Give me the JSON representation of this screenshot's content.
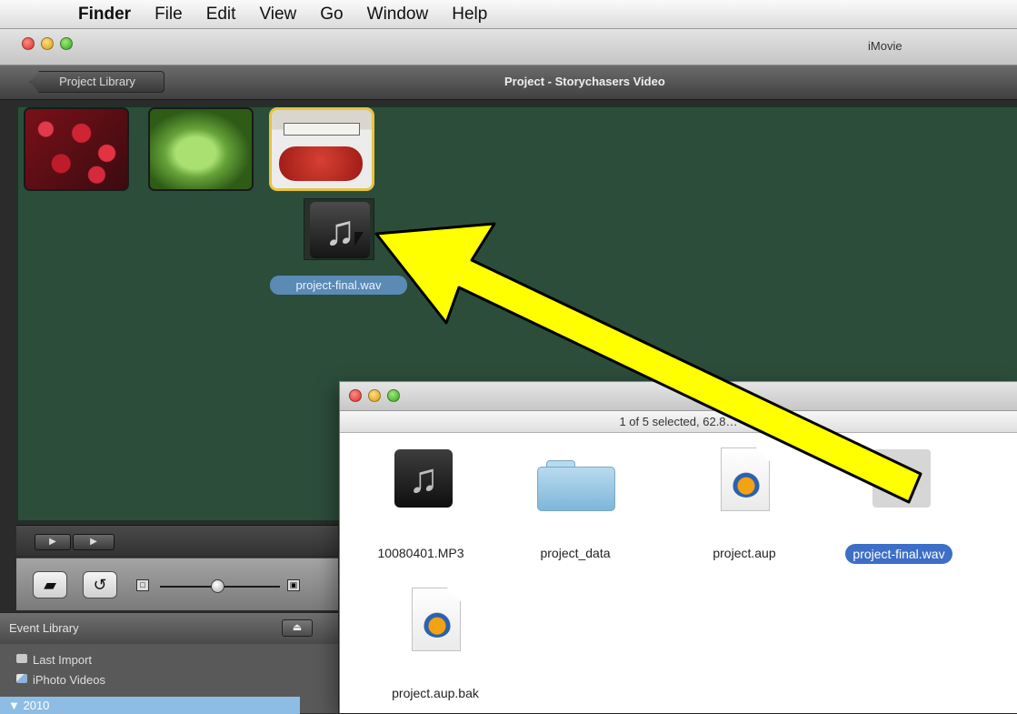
{
  "menu": {
    "app": "Finder",
    "items": [
      "File",
      "Edit",
      "View",
      "Go",
      "Window",
      "Help"
    ]
  },
  "window": {
    "title": "iMovie"
  },
  "project": {
    "library_button": "Project Library",
    "title": "Project - Storychasers Video"
  },
  "drag_label": "project-final.wav",
  "controls": {
    "view_icon": "camera-icon",
    "swap_icon": "rotate-icon"
  },
  "event_library": {
    "header": "Event Library",
    "items": [
      {
        "label": "Last Import",
        "icon": "film-icon"
      },
      {
        "label": "iPhoto Videos",
        "icon": "photo-icon"
      }
    ],
    "year": "2010"
  },
  "finder": {
    "status": "1 of 5 selected, 62.8…",
    "files": [
      {
        "name": "10080401.MP3",
        "icon": "music-file-icon"
      },
      {
        "name": "project_data",
        "icon": "folder-icon"
      },
      {
        "name": "project.aup",
        "icon": "audacity-icon"
      },
      {
        "name": "project-final.wav",
        "icon": "music-file-icon"
      },
      {
        "name": "project.aup.bak",
        "icon": "audacity-icon"
      }
    ]
  },
  "annotation": {
    "arrow_color": "#ffff00",
    "arrow_outline_color": "#000000"
  }
}
